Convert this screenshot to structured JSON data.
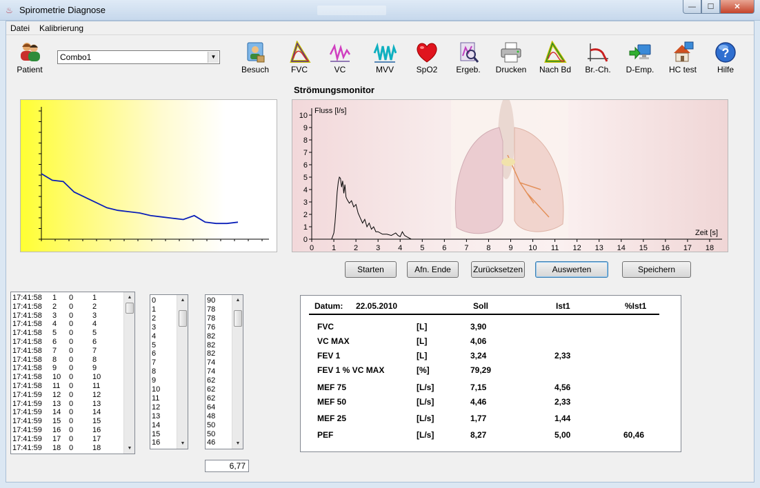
{
  "window": {
    "title": "Spirometrie Diagnose",
    "min": "—",
    "max": "☐",
    "close": "✕"
  },
  "menu": [
    "Datei",
    "Kalibrierung"
  ],
  "toolbar": {
    "patient": "Patient",
    "combo_value": "Combo1",
    "buttons": [
      "Besuch",
      "FVC",
      "VC",
      "MVV",
      "SpO2",
      "Ergeb.",
      "Drucken",
      "Nach Bd",
      "Br.-Ch.",
      "D-Emp.",
      "HC test",
      "Hilfe"
    ]
  },
  "monitor_title": "Strömungsmonitor",
  "flow_chart": {
    "ylabel": "Fluss [l/s]",
    "xlabel": "Zeit [s]",
    "y_ticks": [
      "0",
      "1",
      "2",
      "3",
      "4",
      "5",
      "6",
      "7",
      "8",
      "9",
      "10"
    ],
    "x_ticks": [
      "0",
      "1",
      "2",
      "3",
      "4",
      "5",
      "6",
      "7",
      "8",
      "9",
      "10",
      "11",
      "12",
      "13",
      "14",
      "15",
      "16",
      "17",
      "18"
    ]
  },
  "actions": [
    "Starten",
    "Afn. Ende",
    "Zurücksetzen",
    "Auswerten",
    "Speichern"
  ],
  "log_rows": [
    [
      "17:41:58",
      "1",
      "0",
      "1"
    ],
    [
      "17:41:58",
      "2",
      "0",
      "2"
    ],
    [
      "17:41:58",
      "3",
      "0",
      "3"
    ],
    [
      "17:41:58",
      "4",
      "0",
      "4"
    ],
    [
      "17:41:58",
      "5",
      "0",
      "5"
    ],
    [
      "17:41:58",
      "6",
      "0",
      "6"
    ],
    [
      "17:41:58",
      "7",
      "0",
      "7"
    ],
    [
      "17:41:58",
      "8",
      "0",
      "8"
    ],
    [
      "17:41:58",
      "9",
      "0",
      "9"
    ],
    [
      "17:41:58",
      "10",
      "0",
      "10"
    ],
    [
      "17:41:58",
      "11",
      "0",
      "11"
    ],
    [
      "17:41:59",
      "12",
      "0",
      "12"
    ],
    [
      "17:41:59",
      "13",
      "0",
      "13"
    ],
    [
      "17:41:59",
      "14",
      "0",
      "14"
    ],
    [
      "17:41:59",
      "15",
      "0",
      "15"
    ],
    [
      "17:41:59",
      "16",
      "0",
      "16"
    ],
    [
      "17:41:59",
      "17",
      "0",
      "17"
    ],
    [
      "17:41:59",
      "18",
      "0",
      "18"
    ]
  ],
  "index_list": [
    "0",
    "1",
    "2",
    "3",
    "4",
    "5",
    "6",
    "7",
    "8",
    "9",
    "10",
    "11",
    "12",
    "13",
    "14",
    "15",
    "16"
  ],
  "spo2_list": [
    "90",
    "78",
    "78",
    "76",
    "82",
    "82",
    "82",
    "74",
    "74",
    "62",
    "62",
    "62",
    "64",
    "48",
    "50",
    "50",
    "46"
  ],
  "spo2_value": "6,77",
  "results": {
    "date_label": "Datum:",
    "date": "22.05.2010",
    "col_soll": "Soll",
    "col_ist": "Ist1",
    "col_pct": "%Ist1",
    "rows": [
      {
        "name": "FVC",
        "unit": "[L]",
        "soll": "3,90",
        "ist": "",
        "pct": ""
      },
      {
        "name": "VC MAX",
        "unit": "[L]",
        "soll": "4,06",
        "ist": "",
        "pct": ""
      },
      {
        "name": "FEV 1",
        "unit": "[L]",
        "soll": "3,24",
        "ist": "2,33",
        "pct": ""
      },
      {
        "name": "FEV 1 % VC MAX",
        "unit": "[%]",
        "soll": "79,29",
        "ist": "",
        "pct": ""
      },
      {
        "name": "MEF 75",
        "unit": "[L/s]",
        "soll": "7,15",
        "ist": "4,56",
        "pct": ""
      },
      {
        "name": "MEF 50",
        "unit": "[L/s]",
        "soll": "4,46",
        "ist": "2,33",
        "pct": ""
      },
      {
        "name": "MEF 25",
        "unit": "[L/s]",
        "soll": "1,77",
        "ist": "1,44",
        "pct": ""
      },
      {
        "name": "PEF",
        "unit": "[L/s]",
        "soll": "8,27",
        "ist": "5,00",
        "pct": "60,46"
      }
    ]
  },
  "chart_data": [
    {
      "type": "line",
      "title": "",
      "xlabel": "",
      "ylabel": "",
      "x": [
        0,
        1,
        2,
        3,
        4,
        5,
        6,
        7,
        8,
        9,
        10,
        11,
        12,
        13,
        14,
        15,
        16,
        17,
        18
      ],
      "series": [
        {
          "values": [
            50,
            45,
            44,
            36,
            32,
            28,
            24,
            22,
            21,
            20,
            18,
            17,
            16,
            15,
            18,
            13,
            12,
            12,
            13
          ]
        }
      ],
      "ylim": [
        0,
        100
      ],
      "color": "#0000cc"
    },
    {
      "type": "line",
      "title": "",
      "xlabel": "Zeit [s]",
      "ylabel": "Fluss [l/s]",
      "xlim": [
        0,
        18
      ],
      "ylim": [
        0,
        10
      ],
      "x": [
        0.9,
        1.0,
        1.05,
        1.1,
        1.15,
        1.2,
        1.25,
        1.3,
        1.35,
        1.4,
        1.45,
        1.5,
        1.55,
        1.6,
        1.7,
        1.8,
        1.9,
        2.0,
        2.1,
        2.2,
        2.3,
        2.4,
        2.5,
        2.6,
        2.7,
        2.8,
        2.9,
        3.0,
        3.2,
        3.4,
        3.6,
        3.8,
        3.9,
        4.0,
        4.1,
        4.2,
        4.3,
        4.4,
        4.5
      ],
      "series": [
        {
          "values": [
            0,
            0.5,
            1.3,
            2.5,
            3.8,
            4.6,
            5.0,
            4.9,
            4.2,
            4.7,
            3.7,
            4.4,
            3.4,
            3.2,
            2.9,
            3.1,
            2.6,
            2.8,
            2.1,
            1.7,
            1.3,
            1.6,
            1.0,
            1.3,
            0.8,
            1.0,
            0.6,
            0.6,
            0.4,
            0.4,
            0.3,
            0.5,
            0.3,
            0.2,
            0.6,
            0.3,
            0.2,
            0.1,
            0.0
          ]
        }
      ],
      "color": "#000000",
      "grid": false
    }
  ]
}
